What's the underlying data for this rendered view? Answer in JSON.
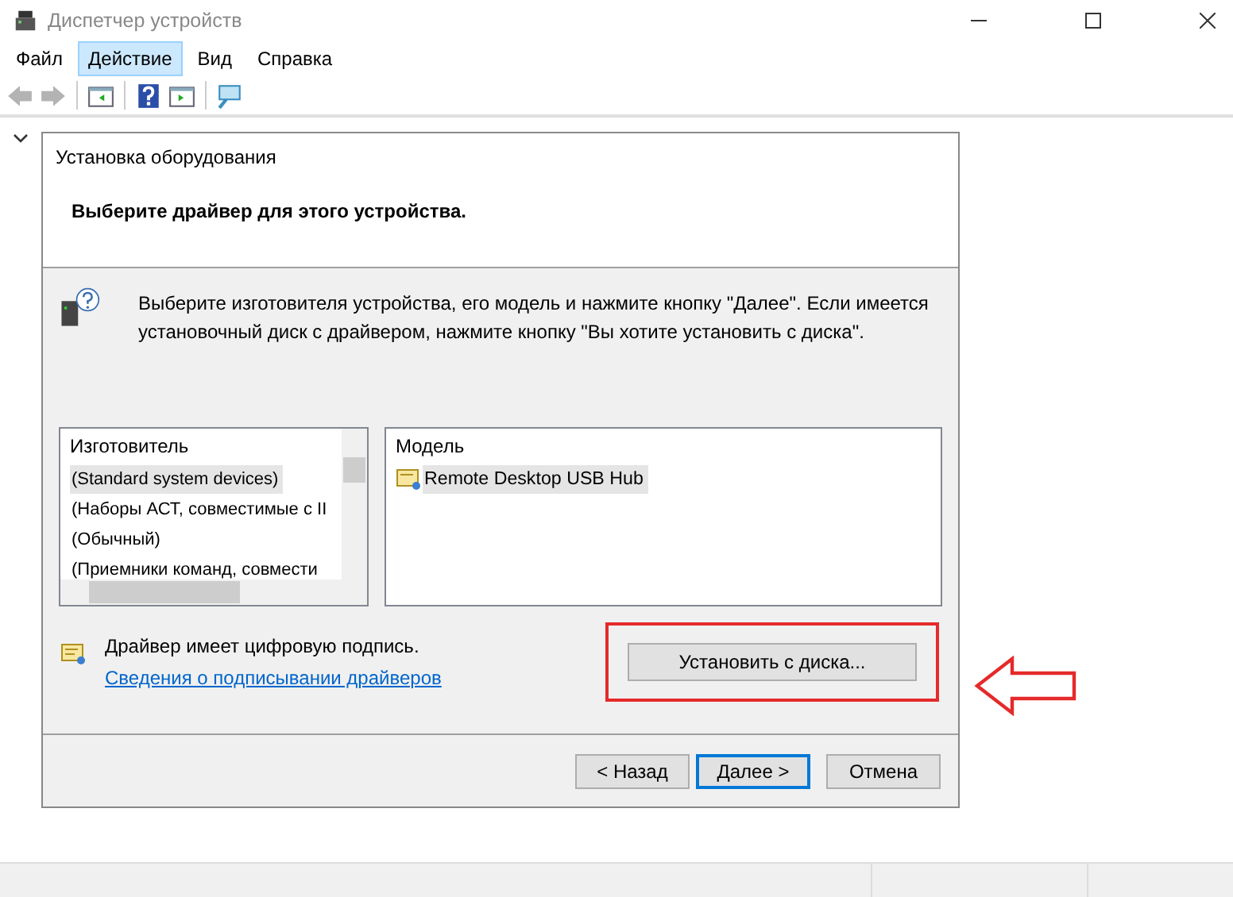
{
  "window": {
    "title": "Диспетчер устройств"
  },
  "menu": [
    {
      "label": "Файл",
      "selected": false
    },
    {
      "label": "Действие",
      "selected": true
    },
    {
      "label": "Вид",
      "selected": false
    },
    {
      "label": "Справка",
      "selected": false
    }
  ],
  "toolbar": [
    {
      "kind": "back",
      "disabled": true
    },
    {
      "kind": "forward",
      "disabled": true
    },
    {
      "kind": "separator"
    },
    {
      "kind": "panel-left",
      "disabled": false
    },
    {
      "kind": "separator"
    },
    {
      "kind": "help",
      "disabled": false
    },
    {
      "kind": "panel-right",
      "disabled": false
    },
    {
      "kind": "separator"
    },
    {
      "kind": "scan",
      "disabled": false
    }
  ],
  "tree": {
    "expanded": true
  },
  "dialog": {
    "title": "Установка оборудования",
    "heading": "Выберите драйвер для этого устройства.",
    "instruction": "Выберите изготовителя устройства, его модель и нажмите кнопку \"Далее\". Если имеется установочный диск с  драйвером, нажмите кнопку \"Вы хотите установить с диска\".",
    "manufacturer_list": {
      "header": "Изготовитель",
      "items": [
        {
          "label": "(Standard system devices)",
          "selected": true
        },
        {
          "label": "(Наборы АСТ, совместимые с II",
          "selected": false
        },
        {
          "label": "(Обычный)",
          "selected": false
        },
        {
          "label": "(Приемники команд, совмести",
          "selected": false
        }
      ]
    },
    "model_list": {
      "header": "Модель",
      "items": [
        {
          "label": "Remote Desktop USB Hub",
          "selected": true
        }
      ]
    },
    "signature_text": "Драйвер имеет цифровую подпись.",
    "signature_link": "Сведения о подписывании драйверов",
    "install_button": {
      "label": "Установить с диска...",
      "highlighted": true
    },
    "buttons": [
      {
        "label": "< Назад",
        "default": false
      },
      {
        "label": "Далее >",
        "default": true
      },
      {
        "label": "Отмена",
        "default": false
      }
    ]
  }
}
